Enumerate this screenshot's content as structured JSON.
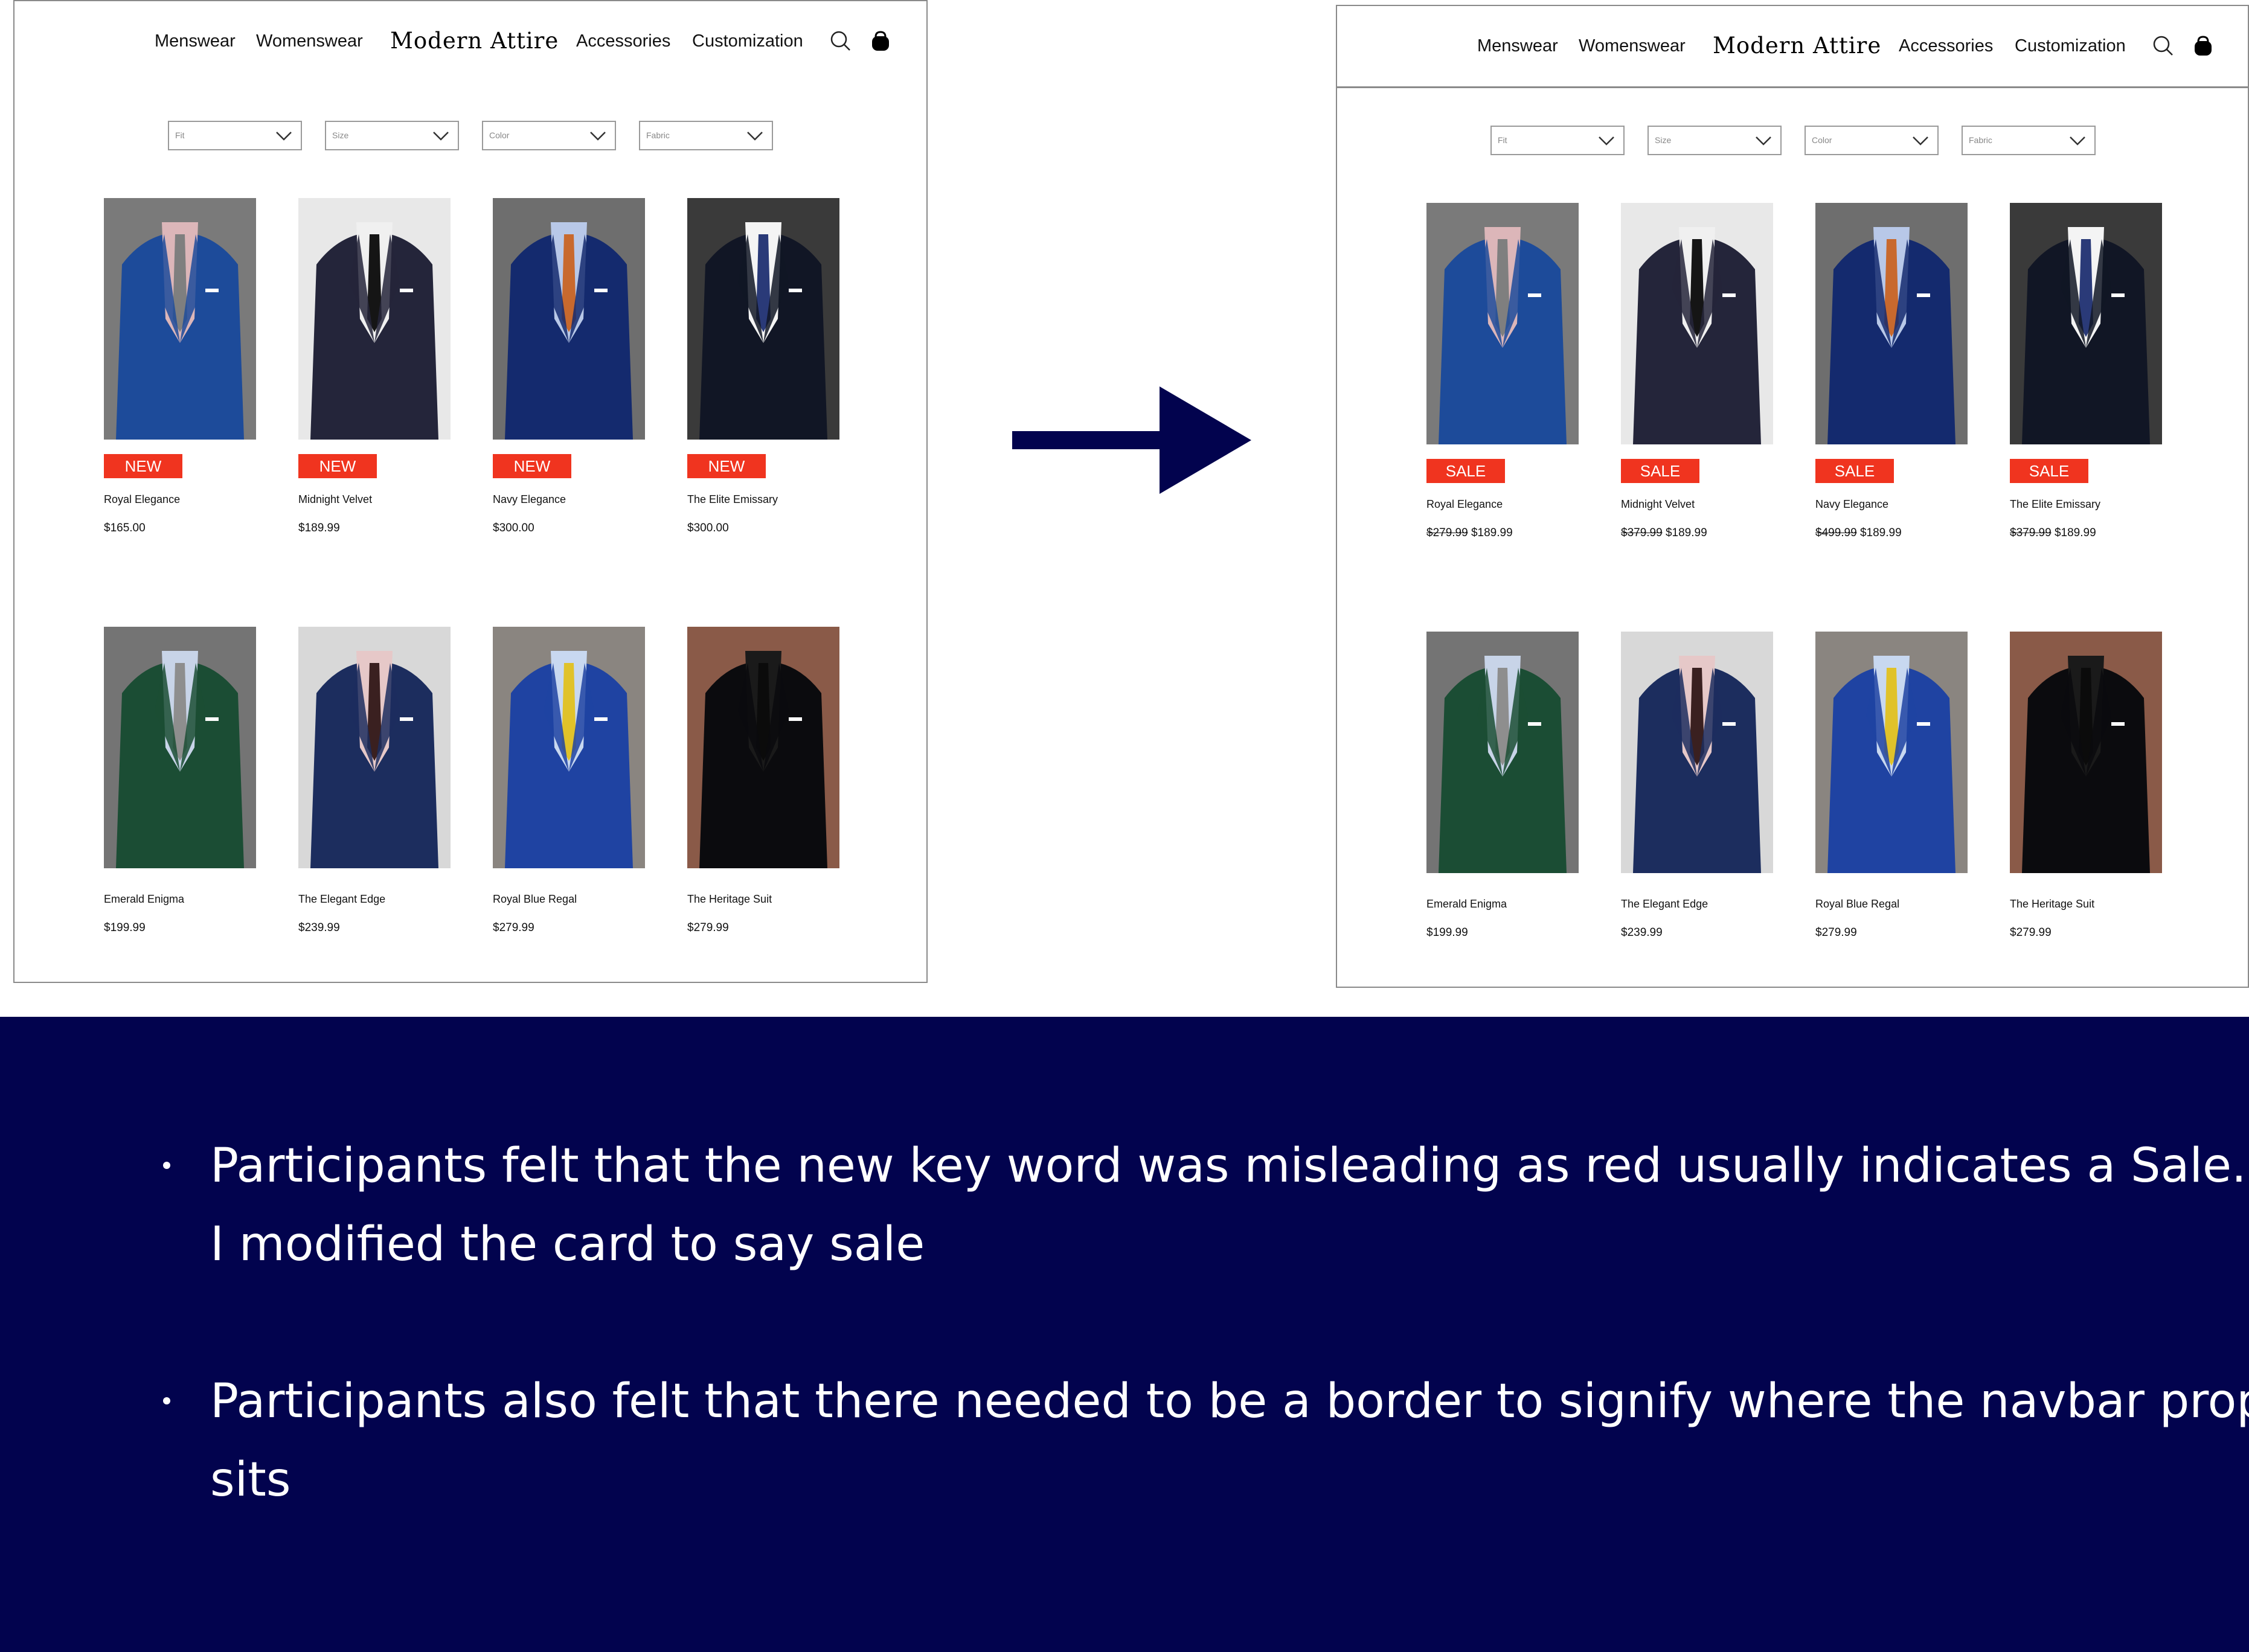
{
  "nav": {
    "menswear": "Menswear",
    "womenswear": "Womenswear",
    "brand": "Modern Attire",
    "accessories": "Accessories",
    "customization": "Customization",
    "search_icon": "search-icon",
    "cart_icon": "bag-icon"
  },
  "filters": [
    "Fit",
    "Size",
    "Color",
    "Fabric"
  ],
  "colors": {
    "badge": "#f0341f",
    "panel": "#02034e",
    "arrow": "#02034e"
  },
  "before": {
    "badge_label": "NEW",
    "products": [
      {
        "name": "Royal Elegance",
        "price": "$165.00",
        "suit": "#1d4b9a",
        "shirt": "#dcb6b9",
        "tie": "#7f7f7f",
        "bg": "#7a7a7a"
      },
      {
        "name": "Midnight Velvet",
        "price": "$189.99",
        "suit": "#24253a",
        "shirt": "#f0f0f0",
        "tie": "#151515",
        "bg": "#e8e8e8"
      },
      {
        "name": "Navy Elegance",
        "price": "$300.00",
        "suit": "#142a6e",
        "shirt": "#b8c8e8",
        "tie": "#c8692e",
        "bg": "#6e6e6e"
      },
      {
        "name": "The Elite Emissary",
        "price": "$300.00",
        "suit": "#111625",
        "shirt": "#f4f4f4",
        "tie": "#2a3a78",
        "bg": "#3a3a3a"
      },
      {
        "name": "Emerald Enigma",
        "price": "$199.99",
        "suit": "#1b4d34",
        "shirt": "#c8d4e8",
        "tie": "#8e8e8e",
        "bg": "#747474"
      },
      {
        "name": "The Elegant Edge",
        "price": "$239.99",
        "suit": "#1c2d5e",
        "shirt": "#e6c8c8",
        "tie": "#3a2020",
        "bg": "#d8d8d8"
      },
      {
        "name": "Royal Blue Regal",
        "price": "$279.99",
        "suit": "#1f43a2",
        "shirt": "#c8d8f0",
        "tie": "#e0c22a",
        "bg": "#8a8580"
      },
      {
        "name": "The Heritage Suit",
        "price": "$279.99",
        "suit": "#0b0b0e",
        "shirt": "#1a1a1a",
        "tie": "#0b0b0b",
        "bg": "#8a5a48"
      }
    ]
  },
  "after": {
    "badge_label": "SALE",
    "products": [
      {
        "name": "Royal Elegance",
        "old_price": "$279.99",
        "price": "$189.99"
      },
      {
        "name": "Midnight Velvet",
        "old_price": "$379.99",
        "price": "$189.99"
      },
      {
        "name": "Navy Elegance",
        "old_price": "$499.99",
        "price": "$189.99"
      },
      {
        "name": "The Elite Emissary",
        "old_price": "$379.99",
        "price": "$189.99"
      },
      {
        "name": "Emerald Enigma",
        "price": "$199.99"
      },
      {
        "name": "The Elegant Edge",
        "price": "$239.99"
      },
      {
        "name": "Royal Blue Regal",
        "price": "$279.99"
      },
      {
        "name": "The Heritage Suit",
        "price": "$279.99"
      }
    ]
  },
  "notes": {
    "bullet1_line1": "Participants felt that the new key word was misleading as red usually indicates a Sale.",
    "bullet1_line2": " I modified the card to say sale",
    "bullet2_line1": "Participants also felt that there needed to be a border to signify where the navbar properly",
    "bullet2_line2": "sits"
  }
}
